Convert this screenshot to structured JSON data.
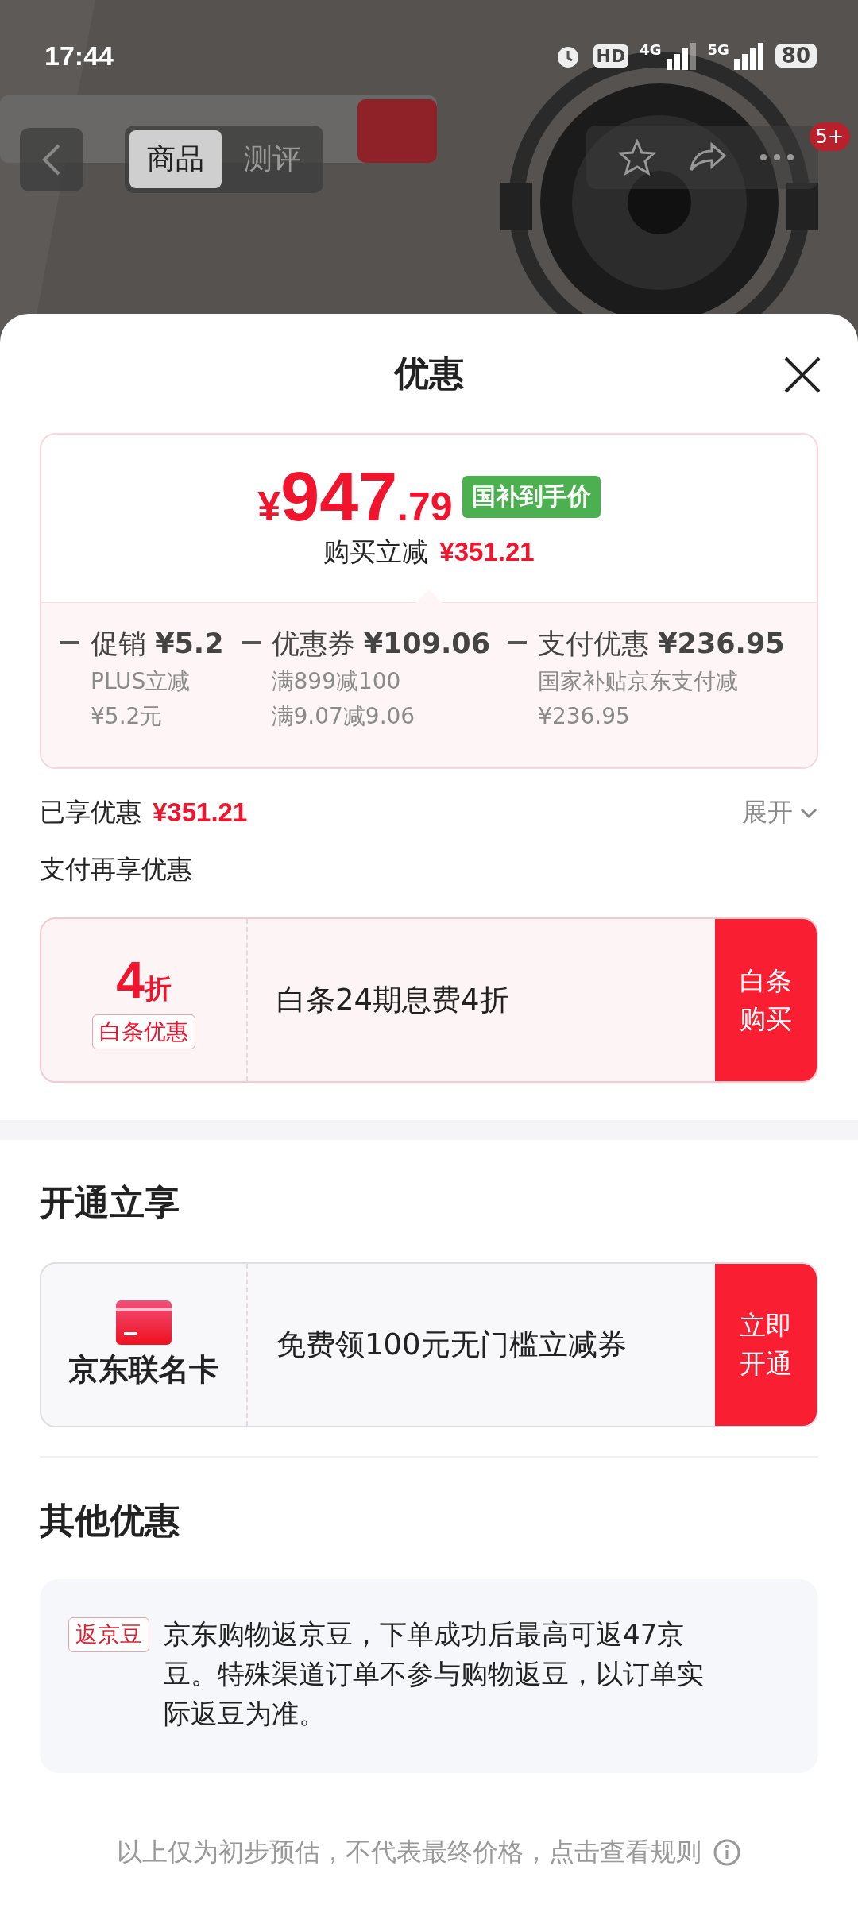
{
  "status_bar": {
    "time": "17:44",
    "hd": "HD",
    "network_1": "4G",
    "network_2": "5G",
    "battery": "80"
  },
  "nav": {
    "tabs": [
      {
        "label": "商品",
        "selected": true
      },
      {
        "label": "测评",
        "selected": false
      }
    ],
    "badge": "5+"
  },
  "sheet": {
    "title": "优惠"
  },
  "price_card": {
    "currency": "¥",
    "price_int": "947",
    "price_dec": ".79",
    "tag": "国补到手价",
    "saving_label": "购买立减",
    "saving_amount": "¥351.21",
    "items": [
      {
        "label": "促销",
        "amount": "¥5.2",
        "details": [
          "PLUS立减",
          "¥5.2元"
        ]
      },
      {
        "label": "优惠券",
        "amount": "¥109.06",
        "details": [
          "满899减100",
          "满9.07减9.06"
        ]
      },
      {
        "label": "支付优惠",
        "amount": "¥236.95",
        "details": [
          "国家补贴京东支付减",
          "¥236.95"
        ]
      }
    ]
  },
  "summary": {
    "label": "已享优惠",
    "amount": "¥351.21",
    "expand": "展开",
    "expanded": false
  },
  "pay_section": {
    "title": "支付再享优惠",
    "offer": {
      "discount_num": "4",
      "discount_unit": "折",
      "tag": "白条优惠",
      "text": "白条24期息费4折",
      "button": "白条购买"
    }
  },
  "open_section": {
    "title": "开通立享",
    "offer": {
      "name": "京东联名卡",
      "text": "免费领100元无门槛立减券",
      "button": "立即开通"
    }
  },
  "other_section": {
    "title": "其他优惠",
    "items": [
      {
        "tag": "返京豆",
        "text": "京东购物返京豆，下单成功后最高可返47京豆。特殊渠道订单不参与购物返豆，以订单实际返豆为准。"
      }
    ]
  },
  "footer": "以上仅为初步预估，不代表最终价格，点击查看规则"
}
